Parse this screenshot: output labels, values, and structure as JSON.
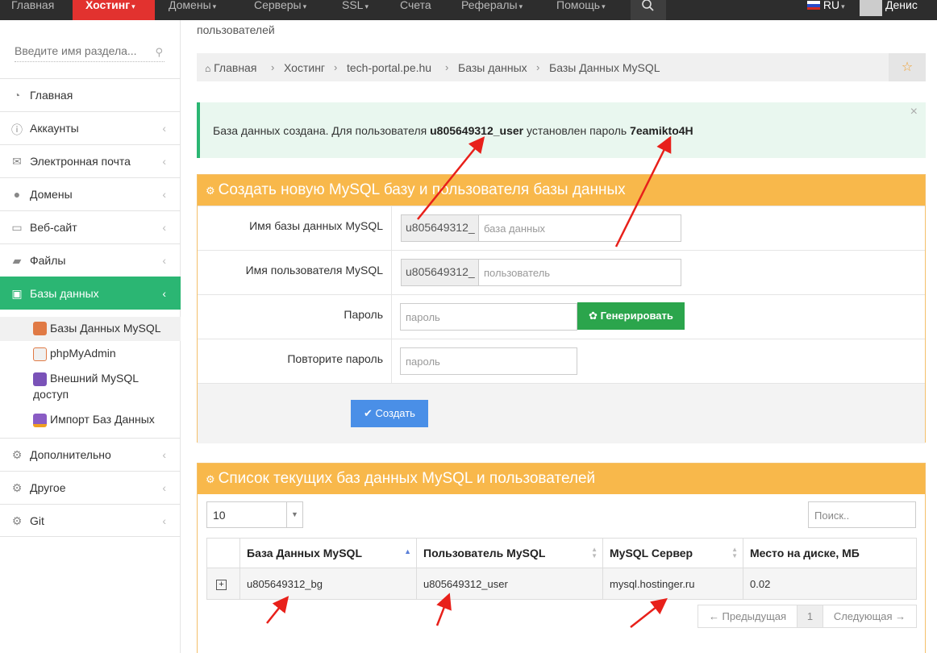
{
  "topnav": {
    "items": [
      {
        "label": "Главная",
        "caret": false
      },
      {
        "label": "Хостинг",
        "caret": true
      },
      {
        "label": "Домены",
        "caret": true
      },
      {
        "label": "Серверы",
        "caret": true
      },
      {
        "label": "SSL",
        "caret": true
      },
      {
        "label": "Счета",
        "caret": false
      },
      {
        "label": "Рефералы",
        "caret": true
      },
      {
        "label": "Помощь",
        "caret": true
      }
    ],
    "lang": "RU",
    "user": "Денис"
  },
  "sidebar": {
    "search_placeholder": "Введите имя раздела...",
    "items": [
      {
        "label": "Главная",
        "icon": "dashboard-icon"
      },
      {
        "label": "Аккаунты",
        "icon": "info-icon"
      },
      {
        "label": "Электронная почта",
        "icon": "envelope-icon"
      },
      {
        "label": "Домены",
        "icon": "globe-icon"
      },
      {
        "label": "Веб-сайт",
        "icon": "monitor-icon"
      },
      {
        "label": "Файлы",
        "icon": "folder-icon"
      },
      {
        "label": "Базы данных",
        "icon": "database-icon"
      }
    ],
    "subitems": [
      {
        "label": "Базы Данных MySQL"
      },
      {
        "label": "phpMyAdmin"
      },
      {
        "label_line1": "Внешний MySQL",
        "label_line2": "доступ"
      },
      {
        "label": "Импорт Баз Данных"
      }
    ],
    "bottom_items": [
      {
        "label": "Дополнительно",
        "icon": "gears-icon"
      },
      {
        "label": "Другое",
        "icon": "gear-icon"
      },
      {
        "label": "Git",
        "icon": "gears-icon"
      }
    ]
  },
  "main": {
    "top_text": "пользователей",
    "breadcrumb": [
      "Главная",
      "Хостинг",
      "tech-portal.pe.hu",
      "Базы данных",
      "Базы Данных MySQL"
    ],
    "alert": {
      "prefix": "База данных создана. Для пользователя ",
      "user": "u805649312_user",
      "middle": " установлен пароль ",
      "password": "7eamikto4H",
      "close": "×"
    },
    "create_panel": {
      "title": "Создать новую MySQL базу и пользователя базы данных",
      "db_label": "Имя базы данных MySQL",
      "db_prefix": "u805649312_",
      "db_placeholder": "база данных",
      "user_label": "Имя пользователя MySQL",
      "user_prefix": "u805649312_",
      "user_placeholder": "пользователь",
      "pass_label": "Пароль",
      "pass_placeholder": "пароль",
      "generate_label": "Генерировать",
      "repeat_label": "Повторите пароль",
      "repeat_placeholder": "пароль",
      "submit_label": "Создать"
    },
    "list_panel": {
      "title": "Список текущих баз данных MySQL и пользователей",
      "page_length": "10",
      "search_placeholder": "Поиск..",
      "columns": [
        "База Данных MySQL",
        "Пользователь MySQL",
        "MySQL Сервер",
        "Место на диске, МБ"
      ],
      "rows": [
        {
          "db": "u805649312_bg",
          "user": "u805649312_user",
          "server": "mysql.hostinger.ru",
          "disk": "0.02"
        }
      ],
      "prev": "← Предыдущая",
      "page": "1",
      "next": "Следующая →"
    }
  },
  "colors": {
    "nav_active": "#e2322f",
    "sidebar_active": "#2bb673",
    "panel_header": "#f8b84b",
    "generate_button": "#2ba54c",
    "submit_button": "#4a8fe7",
    "annotation_arrow": "#e8201a"
  }
}
